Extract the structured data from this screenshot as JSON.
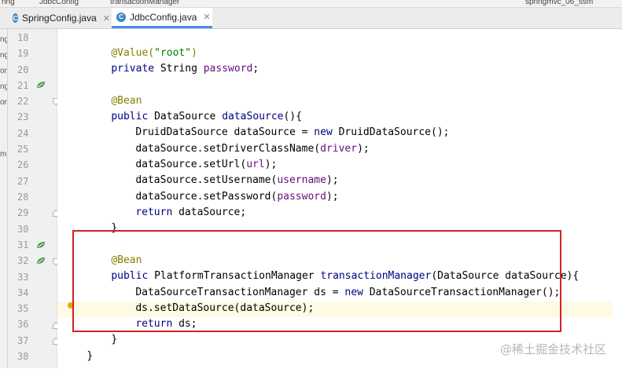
{
  "breadcrumb": {
    "items": [
      "ring",
      "JdbcConfig",
      "transactionManager"
    ],
    "right": "springmvc_06_ssm"
  },
  "tabs": [
    {
      "label": "SpringConfig.java",
      "active": false
    },
    {
      "label": "JdbcConfig.java",
      "active": true
    }
  ],
  "left_strip": [
    "ng",
    "ng",
    "or",
    "ng",
    "or",
    "m"
  ],
  "line_numbers": [
    "18",
    "19",
    "20",
    "21",
    "22",
    "23",
    "24",
    "25",
    "26",
    "27",
    "28",
    "29",
    "30",
    "31",
    "32",
    "33",
    "34",
    "35",
    "36",
    "37",
    "38"
  ],
  "code": {
    "l18": {
      "ann": "@Value(",
      "str": "\"root\"",
      "end": ")"
    },
    "l19": {
      "kw": "private",
      "rest": " String ",
      "fld": "password",
      "end": ";"
    },
    "l21": {
      "ann": "@Bean"
    },
    "l22": {
      "kw": "public",
      "rest": " DataSource ",
      "mth": "dataSource",
      "end": "(){"
    },
    "l23": {
      "a": "DruidDataSource dataSource = ",
      "kw": "new",
      "b": " DruidDataSource();"
    },
    "l24": {
      "a": "dataSource.setDriverClassName(",
      "fld": "driver",
      "b": ");"
    },
    "l25": {
      "a": "dataSource.setUrl(",
      "fld": "url",
      "b": ");"
    },
    "l26": {
      "a": "dataSource.setUsername(",
      "fld": "username",
      "b": ");"
    },
    "l27": {
      "a": "dataSource.setPassword(",
      "fld": "password",
      "b": ");"
    },
    "l28": {
      "kw": "return",
      "rest": " dataSource;"
    },
    "l29": {
      "text": "}"
    },
    "l31": {
      "ann": "@Bean"
    },
    "l32": {
      "kw": "public",
      "rest": " PlatformTransactionManager ",
      "mth": "transactionManager",
      "end": "(DataSource dataSource){"
    },
    "l33": {
      "a": "DataSourceTransactionManager ds = ",
      "kw": "new",
      "b": " DataSourceTransactionManager();"
    },
    "l34": {
      "text": "ds.setDataSource(dataSource);"
    },
    "l35": {
      "kw": "return",
      "rest": " ds;"
    },
    "l36": {
      "text": "}"
    },
    "l37": {
      "text": "}"
    }
  },
  "watermark": "@稀土掘金技术社区",
  "colors": {
    "keyword": "#000080",
    "annotation": "#808000",
    "string": "#008000",
    "field": "#660e7a",
    "highlight_box": "#d22222"
  }
}
